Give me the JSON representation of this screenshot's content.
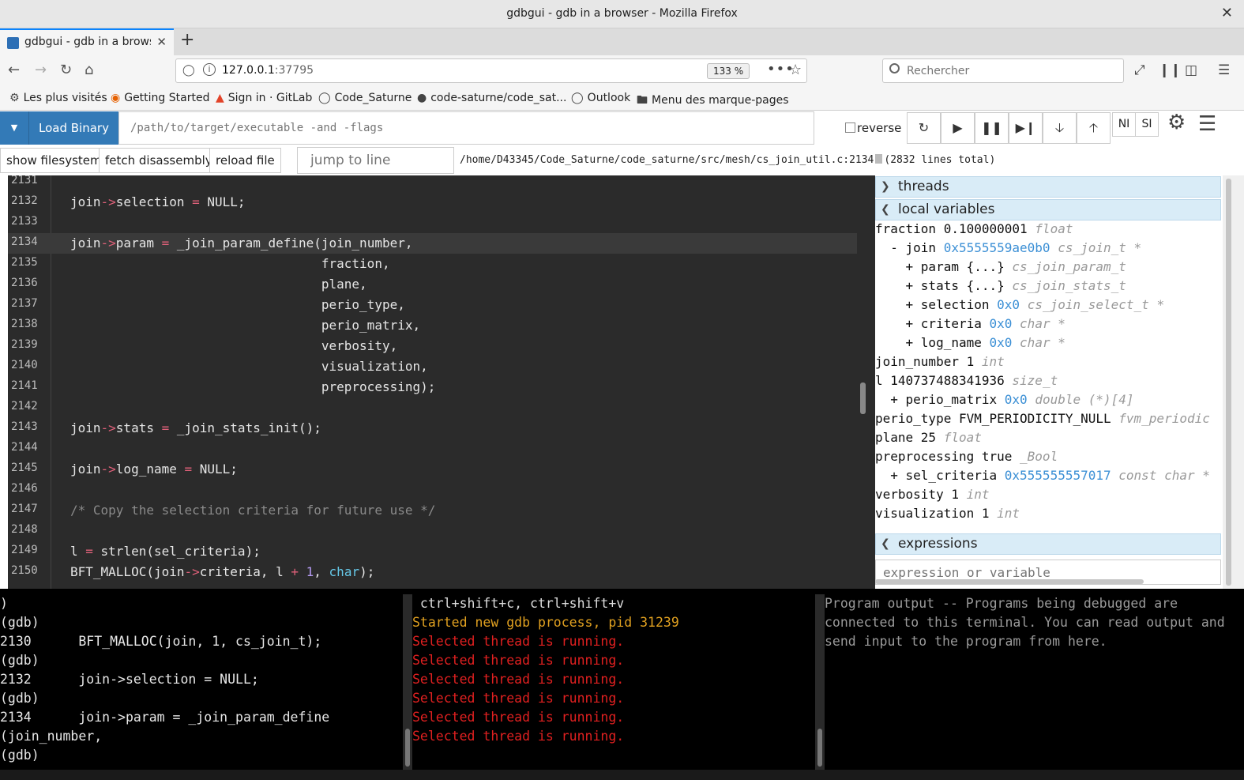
{
  "window": {
    "title": "gdbgui - gdb in a browser - Mozilla Firefox",
    "close": "✕"
  },
  "tab": {
    "title": "gdbgui - gdb in a browser",
    "close": "✕",
    "new": "+"
  },
  "nav": {
    "url_host": "127.0.0.1",
    "url_port": ":37795",
    "zoom": "133 %",
    "search_placeholder": "Rechercher"
  },
  "bookmarks": [
    {
      "label": "Les plus visités",
      "icon": "gear-icon"
    },
    {
      "label": "Getting Started",
      "icon": "firefox-icon"
    },
    {
      "label": "Sign in · GitLab",
      "icon": "gitlab-icon"
    },
    {
      "label": "Code_Saturne",
      "icon": "globe-icon"
    },
    {
      "label": "code-saturne/code_sat...",
      "icon": "github-icon"
    },
    {
      "label": "Outlook",
      "icon": "globe-icon"
    },
    {
      "label": "Menu des marque-pages",
      "icon": "folder-icon"
    }
  ],
  "gdbgui": {
    "load_binary": "Load Binary",
    "binary_placeholder": "/path/to/target/executable -and -flags",
    "reverse": "reverse",
    "ni": "NI",
    "si": "SI",
    "show_filesystem": "show filesystem",
    "fetch_disassembly": "fetch disassembly",
    "reload_file": "reload file",
    "jump_placeholder": "jump to line",
    "file_path": "/home/D43345/Code_Saturne/code_saturne/src/mesh/cs_join_util.c:2134",
    "lines_total": "(2832 lines total)"
  },
  "code": [
    {
      "n": "2131",
      "parts": []
    },
    {
      "n": "2132",
      "parts": [
        [
          "",
          "join"
        ],
        [
          "op",
          "->"
        ],
        [
          "",
          "selection "
        ],
        [
          "op",
          "="
        ],
        [
          "",
          " NULL;"
        ]
      ]
    },
    {
      "n": "2133",
      "parts": []
    },
    {
      "n": "2134",
      "current": true,
      "parts": [
        [
          "",
          "join"
        ],
        [
          "op",
          "->"
        ],
        [
          "",
          "param "
        ],
        [
          "op",
          "="
        ],
        [
          "",
          " _join_param_define(join_number,"
        ]
      ]
    },
    {
      "n": "2135",
      "parts": [
        [
          "",
          "                                 fraction,"
        ]
      ]
    },
    {
      "n": "2136",
      "parts": [
        [
          "",
          "                                 plane,"
        ]
      ]
    },
    {
      "n": "2137",
      "parts": [
        [
          "",
          "                                 perio_type,"
        ]
      ]
    },
    {
      "n": "2138",
      "parts": [
        [
          "",
          "                                 perio_matrix,"
        ]
      ]
    },
    {
      "n": "2139",
      "parts": [
        [
          "",
          "                                 verbosity,"
        ]
      ]
    },
    {
      "n": "2140",
      "parts": [
        [
          "",
          "                                 visualization,"
        ]
      ]
    },
    {
      "n": "2141",
      "parts": [
        [
          "",
          "                                 preprocessing);"
        ]
      ]
    },
    {
      "n": "2142",
      "parts": []
    },
    {
      "n": "2143",
      "parts": [
        [
          "",
          "join"
        ],
        [
          "op",
          "->"
        ],
        [
          "",
          "stats "
        ],
        [
          "op",
          "="
        ],
        [
          "",
          " _join_stats_init();"
        ]
      ]
    },
    {
      "n": "2144",
      "parts": []
    },
    {
      "n": "2145",
      "parts": [
        [
          "",
          "join"
        ],
        [
          "op",
          "->"
        ],
        [
          "",
          "log_name "
        ],
        [
          "op",
          "="
        ],
        [
          "",
          " NULL;"
        ]
      ]
    },
    {
      "n": "2146",
      "parts": []
    },
    {
      "n": "2147",
      "parts": [
        [
          "cm",
          "/* Copy the selection criteria for future use */"
        ]
      ]
    },
    {
      "n": "2148",
      "parts": []
    },
    {
      "n": "2149",
      "parts": [
        [
          "",
          "l "
        ],
        [
          "op",
          "="
        ],
        [
          "",
          " strlen(sel_criteria);"
        ]
      ]
    },
    {
      "n": "2150",
      "parts": [
        [
          "",
          "BFT_MALLOC(join"
        ],
        [
          "op",
          "->"
        ],
        [
          "",
          "criteria, l "
        ],
        [
          "op",
          "+"
        ],
        [
          "",
          " "
        ],
        [
          "num",
          "1"
        ],
        [
          "",
          ", "
        ],
        [
          "kw",
          "char"
        ],
        [
          "",
          ");"
        ]
      ]
    }
  ],
  "panel": {
    "threads": "threads",
    "local_variables": "local variables",
    "expressions": "expressions",
    "expression_placeholder": "expression or variable",
    "locals": [
      {
        "indent": "",
        "name": "fraction 0.100000001",
        "ptr": "",
        "type": "float"
      },
      {
        "indent": "  - ",
        "name": "join",
        "ptr": "0x5555559ae0b0",
        "type": "cs_join_t *"
      },
      {
        "indent": "    + ",
        "name": "param {...}",
        "ptr": "",
        "type": "cs_join_param_t"
      },
      {
        "indent": "    + ",
        "name": "stats {...}",
        "ptr": "",
        "type": "cs_join_stats_t"
      },
      {
        "indent": "    + ",
        "name": "selection",
        "ptr": "0x0",
        "type": "cs_join_select_t *"
      },
      {
        "indent": "    + ",
        "name": "criteria",
        "ptr": "0x0",
        "type": "char *"
      },
      {
        "indent": "    + ",
        "name": "log_name",
        "ptr": "0x0",
        "type": "char *"
      },
      {
        "indent": "",
        "name": "join_number 1",
        "ptr": "",
        "type": "int"
      },
      {
        "indent": "",
        "name": "l 140737488341936",
        "ptr": "",
        "type": "size_t"
      },
      {
        "indent": "  + ",
        "name": "perio_matrix",
        "ptr": "0x0",
        "type": "double (*)[4]"
      },
      {
        "indent": "",
        "name": "perio_type FVM_PERIODICITY_NULL",
        "ptr": "",
        "type": "fvm_periodic"
      },
      {
        "indent": "",
        "name": "plane 25",
        "ptr": "",
        "type": "float"
      },
      {
        "indent": "",
        "name": "preprocessing true",
        "ptr": "",
        "type": "_Bool"
      },
      {
        "indent": "  + ",
        "name": "sel_criteria",
        "ptr": "0x555555557017",
        "type": "const char *"
      },
      {
        "indent": "",
        "name": "verbosity 1",
        "ptr": "",
        "type": "int"
      },
      {
        "indent": "",
        "name": "visualization 1",
        "ptr": "",
        "type": "int"
      }
    ]
  },
  "terminals": {
    "gdb": [
      ")",
      "(gdb)",
      "2130      BFT_MALLOC(join, 1, cs_join_t);",
      "(gdb)",
      "2132      join->selection = NULL;",
      "(gdb)",
      "2134      join->param = _join_param_define",
      "(join_number,",
      "(gdb)"
    ],
    "gdbgui": [
      {
        "c": "white",
        "t": " ctrl+shift+c, ctrl+shift+v"
      },
      {
        "c": "yellow",
        "t": "Started new gdb process, pid 31239"
      },
      {
        "c": "red",
        "t": "Selected thread is running."
      },
      {
        "c": "red",
        "t": "Selected thread is running."
      },
      {
        "c": "red",
        "t": "Selected thread is running."
      },
      {
        "c": "red",
        "t": "Selected thread is running."
      },
      {
        "c": "red",
        "t": "Selected thread is running."
      },
      {
        "c": "red",
        "t": "Selected thread is running."
      }
    ],
    "program_output": "Program output -- Programs being debugged are connected to this terminal. You can read output and send input to the program from here."
  }
}
